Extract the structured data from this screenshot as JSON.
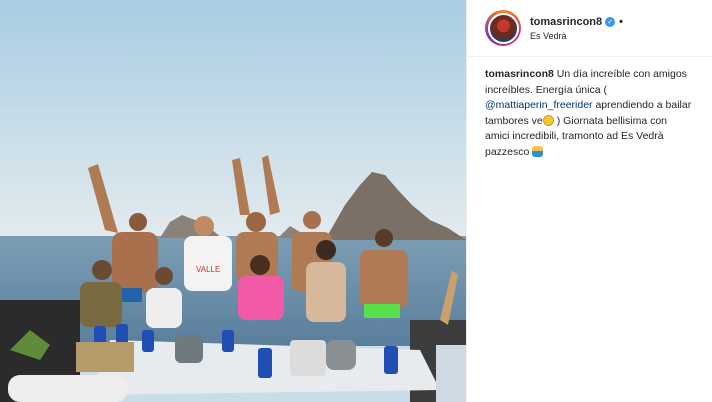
{
  "post": {
    "username": "tomasrincon8",
    "verified_icon": "verified-badge-icon",
    "more_indicator": "•",
    "location": "Es Vedrà",
    "caption": {
      "user": "tomasrincon8",
      "part1": "Un día increíble con amigos increíbles. Energía única (",
      "mention": "@mattiaperin_freerider",
      "part2": "aprendiendo a bailar tambores ve",
      "part3": ") Giornata bellisima con amici incredibili, tramonto ad Es Vedrà pazzesco"
    }
  },
  "photo": {
    "description_icon": "group-photo",
    "sign_text": "VALLE"
  },
  "colors": {
    "sky_top": "#aecfe4",
    "sea": "#6f95b0",
    "accent_blue": "#3897f0",
    "mention": "#003569"
  }
}
